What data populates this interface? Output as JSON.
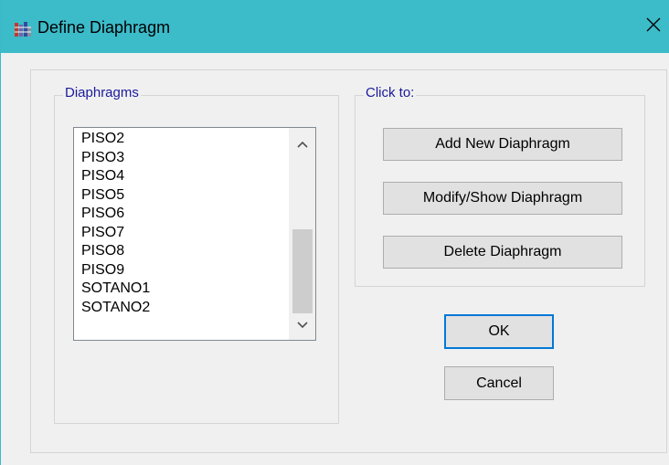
{
  "window": {
    "title": "Define Diaphragm"
  },
  "icons": {
    "app": "etabs-app-icon",
    "close": "close-icon",
    "scroll_up": "chevron-up-icon",
    "scroll_down": "chevron-down-icon"
  },
  "diaphragms_group": {
    "label": "Diaphragms",
    "items": [
      "PISO2",
      "PISO3",
      "PISO4",
      "PISO5",
      "PISO6",
      "PISO7",
      "PISO8",
      "PISO9",
      "SOTANO1",
      "SOTANO2"
    ]
  },
  "click_to_group": {
    "label": "Click to:",
    "add_label": "Add New Diaphragm",
    "modify_label": "Modify/Show Diaphragm",
    "delete_label": "Delete Diaphragm"
  },
  "buttons": {
    "ok_label": "OK",
    "cancel_label": "Cancel"
  },
  "colors": {
    "titlebar": "#3cbbc9",
    "group_label": "#1a1a9c",
    "default_button_border": "#0078d7"
  }
}
